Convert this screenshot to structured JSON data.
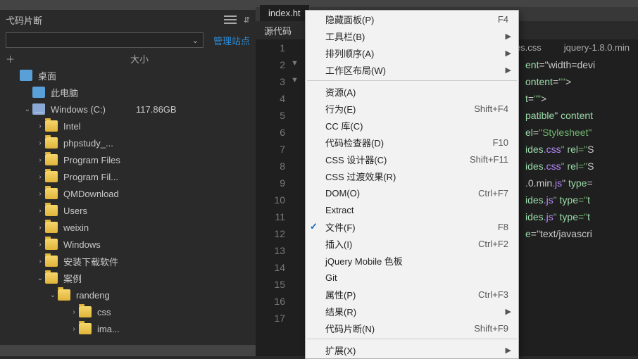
{
  "panel": {
    "snippets_title": "弋码片断",
    "toggle_label": "⇵",
    "manage_sites": "管理站点",
    "size_header": "大小",
    "plus": "＋"
  },
  "tree": [
    {
      "depth": 1,
      "arrow": "",
      "icon": "desk",
      "label": "桌面",
      "size": ""
    },
    {
      "depth": 2,
      "arrow": "",
      "icon": "pc",
      "label": "此电脑",
      "size": ""
    },
    {
      "depth": 2,
      "arrow": "v",
      "icon": "disk",
      "label": "Windows (C:)",
      "size": "117.86GB"
    },
    {
      "depth": 3,
      "arrow": ">",
      "icon": "folder",
      "label": "Intel",
      "size": ""
    },
    {
      "depth": 3,
      "arrow": ">",
      "icon": "folder",
      "label": "phpstudy_...",
      "size": ""
    },
    {
      "depth": 3,
      "arrow": ">",
      "icon": "folder",
      "label": "Program Files",
      "size": ""
    },
    {
      "depth": 3,
      "arrow": ">",
      "icon": "folder",
      "label": "Program Fil...",
      "size": ""
    },
    {
      "depth": 3,
      "arrow": ">",
      "icon": "folder",
      "label": "QMDownload",
      "size": ""
    },
    {
      "depth": 3,
      "arrow": ">",
      "icon": "folder",
      "label": "Users",
      "size": ""
    },
    {
      "depth": 3,
      "arrow": ">",
      "icon": "folder",
      "label": "weixin",
      "size": ""
    },
    {
      "depth": 3,
      "arrow": ">",
      "icon": "folder",
      "label": "Windows",
      "size": ""
    },
    {
      "depth": 3,
      "arrow": ">",
      "icon": "folder",
      "label": "安装下载软件",
      "size": ""
    },
    {
      "depth": 3,
      "arrow": "v",
      "icon": "folder",
      "label": "案例",
      "size": ""
    },
    {
      "depth": 4,
      "arrow": "v",
      "icon": "folder",
      "label": "randeng",
      "size": ""
    },
    {
      "depth": 5,
      "arrow": ">",
      "icon": "folder",
      "label": "css",
      "size": ""
    },
    {
      "depth": 5,
      "arrow": ">",
      "icon": "folder",
      "label": "ima...",
      "size": ""
    }
  ],
  "tabs": {
    "main": "index.ht",
    "sub": "源代码"
  },
  "right_tabs": [
    "es.css",
    "jquery-1.8.0.min"
  ],
  "gutter": [
    "1",
    "2",
    "3",
    "4",
    "5",
    "6",
    "7",
    "8",
    "9",
    "10",
    "11",
    "12",
    "13",
    "14",
    "15",
    "16",
    "17"
  ],
  "folds": [
    {
      "line": 2,
      "g": "▼"
    },
    {
      "line": 3,
      "g": "▼"
    }
  ],
  "code_lines": [
    "",
    "",
    "",
    "",
    "",
    "",
    "ent=\"width=devi",
    "ontent=\"\">",
    "t=\"\">",
    "patible\" content",
    "el=\"Stylesheet\" ",
    "ides.css\" rel=\"S",
    "ides.css\" rel=\"S",
    ".0.min.js\" type=",
    "ides.js\" type=\"t",
    "ides.js\" type=\"t",
    "e=\"text/javascri"
  ],
  "menu": [
    {
      "t": "item",
      "label": "隐藏面板(P)",
      "shortcut": "F4"
    },
    {
      "t": "item",
      "label": "工具栏(B)",
      "sub": true
    },
    {
      "t": "item",
      "label": "排列顺序(A)",
      "sub": true
    },
    {
      "t": "item",
      "label": "工作区布局(W)",
      "sub": true
    },
    {
      "t": "sep"
    },
    {
      "t": "item",
      "label": "资源(A)"
    },
    {
      "t": "item",
      "label": "行为(E)",
      "shortcut": "Shift+F4"
    },
    {
      "t": "item",
      "label": "CC 库(C)"
    },
    {
      "t": "item",
      "label": "代码检查器(D)",
      "shortcut": "F10"
    },
    {
      "t": "item",
      "label": "CSS 设计器(C)",
      "shortcut": "Shift+F11"
    },
    {
      "t": "item",
      "label": "CSS 过渡效果(R)"
    },
    {
      "t": "item",
      "label": "DOM(O)",
      "shortcut": "Ctrl+F7"
    },
    {
      "t": "item",
      "label": "Extract"
    },
    {
      "t": "item",
      "label": "文件(F)",
      "check": true,
      "shortcut": "F8"
    },
    {
      "t": "item",
      "label": "插入(I)",
      "shortcut": "Ctrl+F2"
    },
    {
      "t": "item",
      "label": "jQuery Mobile 色板"
    },
    {
      "t": "item",
      "label": "Git"
    },
    {
      "t": "item",
      "label": "属性(P)",
      "shortcut": "Ctrl+F3"
    },
    {
      "t": "item",
      "label": "结果(R)",
      "sub": true
    },
    {
      "t": "item",
      "label": "代码片断(N)",
      "shortcut": "Shift+F9"
    },
    {
      "t": "sep"
    },
    {
      "t": "item",
      "label": "扩展(X)",
      "sub": true
    }
  ]
}
